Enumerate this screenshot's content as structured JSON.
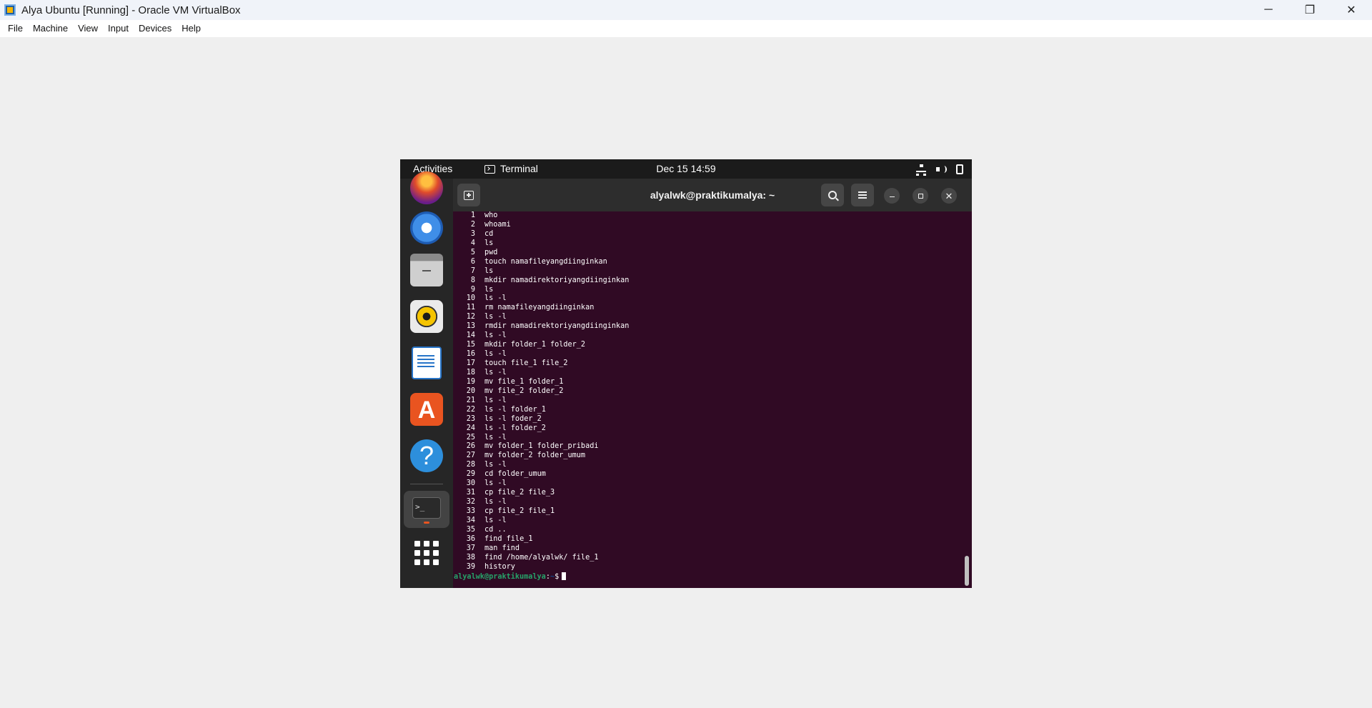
{
  "host": {
    "title": "Alya Ubuntu [Running] - Oracle VM VirtualBox",
    "menu": [
      "File",
      "Machine",
      "View",
      "Input",
      "Devices",
      "Help"
    ],
    "controls": {
      "minimize": "─",
      "restore": "❐",
      "close": "✕"
    }
  },
  "gnome": {
    "activities": "Activities",
    "app_name": "Terminal",
    "clock": "Dec 15  14:59",
    "tray_icons": [
      "network-icon",
      "volume-icon",
      "power-icon"
    ]
  },
  "dock": {
    "apps": [
      "firefox-icon",
      "thunderbird-icon",
      "files-icon",
      "rhythmbox-icon",
      "libreoffice-writer-icon",
      "app-center-icon",
      "help-icon",
      "terminal-icon",
      "show-apps-icon"
    ],
    "help_glyph": "?",
    "appcenter_glyph": "A",
    "terminal_glyph": ">_"
  },
  "terminal": {
    "title": "alyalwk@praktikumalya: ~",
    "close_glyph": "✕",
    "history": [
      {
        "n": "1",
        "cmd": "who"
      },
      {
        "n": "2",
        "cmd": "whoami"
      },
      {
        "n": "3",
        "cmd": "cd"
      },
      {
        "n": "4",
        "cmd": "ls"
      },
      {
        "n": "5",
        "cmd": "pwd"
      },
      {
        "n": "6",
        "cmd": "touch namafileyangdiinginkan"
      },
      {
        "n": "7",
        "cmd": "ls"
      },
      {
        "n": "8",
        "cmd": "mkdir namadirektoriyangdiinginkan"
      },
      {
        "n": "9",
        "cmd": "ls"
      },
      {
        "n": "10",
        "cmd": "ls -l"
      },
      {
        "n": "11",
        "cmd": "rm namafileyangdiinginkan"
      },
      {
        "n": "12",
        "cmd": "ls -l"
      },
      {
        "n": "13",
        "cmd": "rmdir namadirektoriyangdiinginkan"
      },
      {
        "n": "14",
        "cmd": "ls -l"
      },
      {
        "n": "15",
        "cmd": "mkdir folder_1 folder_2"
      },
      {
        "n": "16",
        "cmd": "ls -l"
      },
      {
        "n": "17",
        "cmd": "touch file_1 file_2"
      },
      {
        "n": "18",
        "cmd": "ls -l"
      },
      {
        "n": "19",
        "cmd": "mv file_1 folder_1"
      },
      {
        "n": "20",
        "cmd": "mv file_2 folder_2"
      },
      {
        "n": "21",
        "cmd": "ls -l"
      },
      {
        "n": "22",
        "cmd": "ls -l folder_1"
      },
      {
        "n": "23",
        "cmd": "ls -l foder_2"
      },
      {
        "n": "24",
        "cmd": "ls -l folder_2"
      },
      {
        "n": "25",
        "cmd": "ls -l"
      },
      {
        "n": "26",
        "cmd": "mv folder_1 folder_pribadi"
      },
      {
        "n": "27",
        "cmd": "mv folder_2 folder_umum"
      },
      {
        "n": "28",
        "cmd": "ls -l"
      },
      {
        "n": "29",
        "cmd": "cd folder_umum"
      },
      {
        "n": "30",
        "cmd": "ls -l"
      },
      {
        "n": "31",
        "cmd": "cp file_2 file_3"
      },
      {
        "n": "32",
        "cmd": "ls -l"
      },
      {
        "n": "33",
        "cmd": "cp file_2 file_1"
      },
      {
        "n": "34",
        "cmd": "ls -l"
      },
      {
        "n": "35",
        "cmd": "cd .."
      },
      {
        "n": "36",
        "cmd": "find file_1"
      },
      {
        "n": "37",
        "cmd": "man find"
      },
      {
        "n": "38",
        "cmd": "find /home/alyalwk/ file_1"
      },
      {
        "n": "39",
        "cmd": "history"
      }
    ],
    "prompt": {
      "user_host": "alyalwk@praktikumalya",
      "sep": ":",
      "path": "~",
      "dollar": "$"
    },
    "colors": {
      "background": "#300a24",
      "prompt_user": "#26a269",
      "prompt_path": "#12488b",
      "accent": "#e95420"
    }
  }
}
